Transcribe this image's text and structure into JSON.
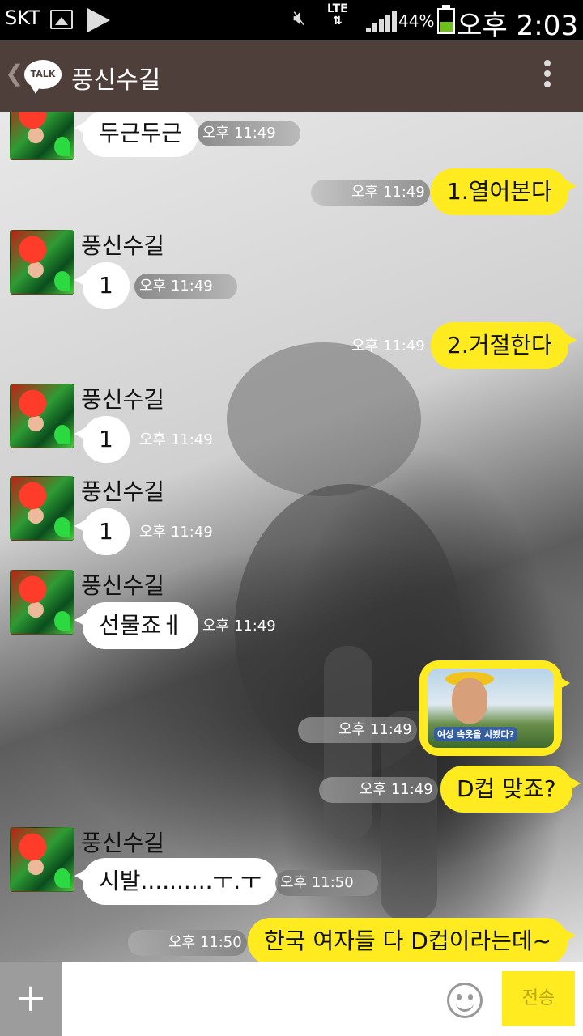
{
  "status_bar": {
    "carrier": "SKT",
    "network": "LTE",
    "battery_percent": "44%",
    "clock": "오후 2:03",
    "icons": [
      "image-icon",
      "play-icon",
      "mute-icon",
      "signal-icon",
      "battery-icon"
    ]
  },
  "header": {
    "logo_text": "TALK",
    "title": "풍신수길"
  },
  "messages": [
    {
      "text": "두근두근",
      "time": "오후 11:49"
    },
    {
      "text": "1.열어본다",
      "time": "오후 11:49"
    },
    {
      "sender": "풍신수길",
      "text": "1",
      "time": "오후 11:49"
    },
    {
      "text": "2.거절한다",
      "time": "오후 11:49"
    },
    {
      "sender": "풍신수길",
      "text": "1",
      "time": "오후 11:49"
    },
    {
      "sender": "풍신수길",
      "text": "1",
      "time": "오후 11:49"
    },
    {
      "sender": "풍신수길",
      "text": "선물죠ㅔ",
      "time": "오후 11:49"
    },
    {
      "image_caption": "여성 속옷을 사봤다?",
      "time": "오후 11:49"
    },
    {
      "text": "D컵 맞죠?",
      "time": "오후 11:49"
    },
    {
      "sender": "풍신수길",
      "text": "시발..........ㅜ.ㅜ",
      "time": "오후 11:50"
    },
    {
      "text": "한국 여자들 다 D컵이라는데~",
      "time": "오후 11:50"
    }
  ],
  "input": {
    "placeholder": "",
    "send_label": "전송"
  },
  "colors": {
    "header_bg": "#4f3f3b",
    "outgoing_bubble": "#ffeb1f",
    "incoming_bubble": "#ffffff"
  }
}
